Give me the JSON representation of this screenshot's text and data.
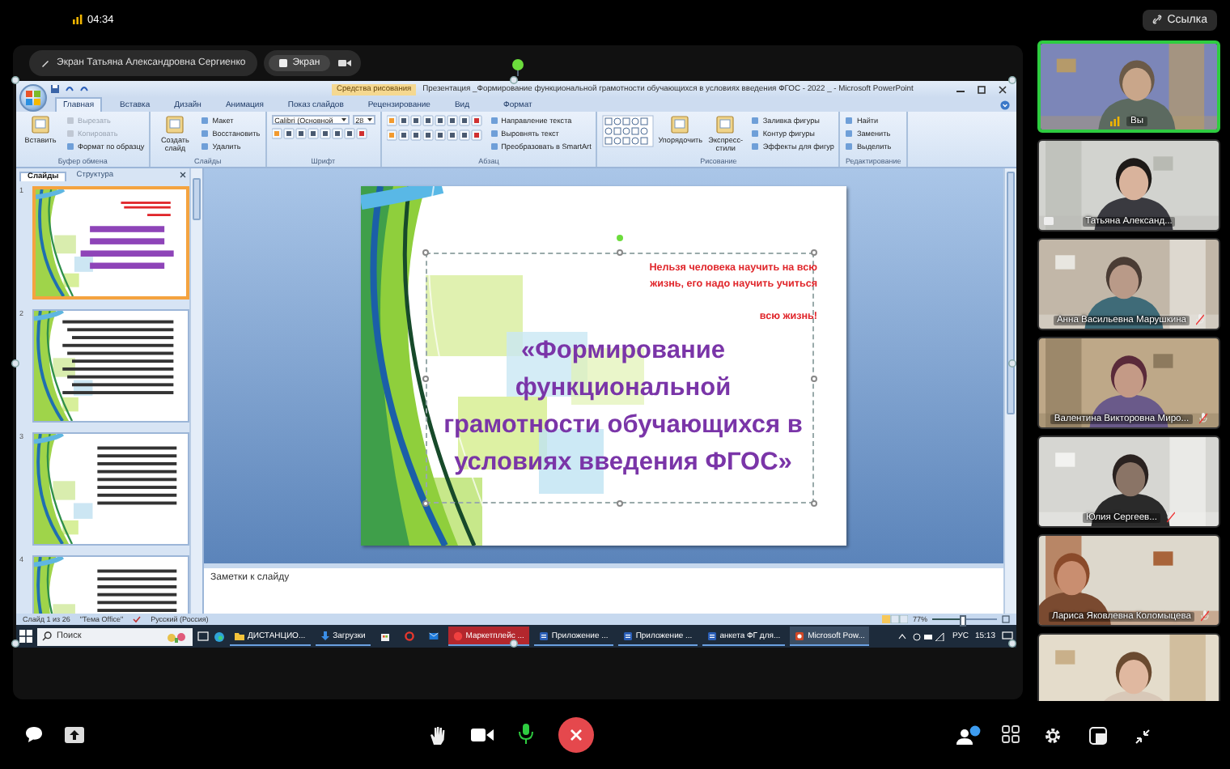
{
  "status_bar": {
    "time": "04:34"
  },
  "link_button": "Ссылка",
  "share_pills": [
    {
      "label": "Экран Татьяна Александровна Сергиенко",
      "kind": "presenter"
    },
    {
      "label": "Экран",
      "kind": "screen"
    }
  ],
  "powerpoint": {
    "title": "Презентация _Формирование функциональной грамотности обучающихся в условиях введения ФГОС - 2022 _ - Microsoft PowerPoint",
    "context_tab": "Средства рисования",
    "tabs": [
      {
        "label": "Главная",
        "selected": true
      },
      {
        "label": "Вставка",
        "selected": false
      },
      {
        "label": "Дизайн",
        "selected": false
      },
      {
        "label": "Анимация",
        "selected": false
      },
      {
        "label": "Показ слайдов",
        "selected": false
      },
      {
        "label": "Рецензирование",
        "selected": false
      },
      {
        "label": "Вид",
        "selected": false
      },
      {
        "label": "Формат",
        "selected": false
      }
    ],
    "ribbon_groups": [
      {
        "title": "Буфер обмена",
        "columns": [
          [
            {
              "kind": "large",
              "label": "Вставить"
            }
          ],
          [
            {
              "kind": "small",
              "label": "Вырезать",
              "disabled": true
            },
            {
              "kind": "small",
              "label": "Копировать",
              "disabled": true
            },
            {
              "kind": "small",
              "label": "Формат по образцу",
              "disabled": false
            }
          ]
        ]
      },
      {
        "title": "Слайды",
        "columns": [
          [
            {
              "kind": "large",
              "label": "Создать слайд"
            }
          ],
          [
            {
              "kind": "small",
              "label": "Макет",
              "disabled": false
            },
            {
              "kind": "small",
              "label": "Восстановить",
              "disabled": false
            },
            {
              "kind": "small",
              "label": "Удалить",
              "disabled": false
            }
          ]
        ]
      },
      {
        "title": "Шрифт",
        "columns": [
          [
            {
              "kind": "fields",
              "fields": [
                "Calibri (Основной",
                "28"
              ]
            },
            {
              "kind": "tools"
            }
          ]
        ]
      },
      {
        "title": "Абзац",
        "columns": [
          [
            {
              "kind": "tools"
            },
            {
              "kind": "tools"
            }
          ],
          [
            {
              "kind": "small",
              "label": "Направление текста",
              "disabled": false
            },
            {
              "kind": "small",
              "label": "Выровнять текст",
              "disabled": false
            },
            {
              "kind": "small",
              "label": "Преобразовать в SmartArt",
              "disabled": false
            }
          ]
        ]
      },
      {
        "title": "Рисование",
        "columns": [
          [
            {
              "kind": "gallery"
            }
          ],
          [
            {
              "kind": "large",
              "label": "Упорядочить"
            }
          ],
          [
            {
              "kind": "large",
              "label": "Экспресс-стили"
            }
          ],
          [
            {
              "kind": "small",
              "label": "Заливка фигуры",
              "disabled": false
            },
            {
              "kind": "small",
              "label": "Контур фигуры",
              "disabled": false
            },
            {
              "kind": "small",
              "label": "Эффекты для фигур",
              "disabled": false
            }
          ]
        ]
      },
      {
        "title": "Редактирование",
        "columns": [
          [
            {
              "kind": "small",
              "label": "Найти",
              "disabled": false
            },
            {
              "kind": "small",
              "label": "Заменить",
              "disabled": false
            },
            {
              "kind": "small",
              "label": "Выделить",
              "disabled": false
            }
          ]
        ]
      }
    ],
    "pane_tabs": [
      {
        "label": "Слайды",
        "selected": true
      },
      {
        "label": "Структура",
        "selected": false
      }
    ],
    "thumbnails": [
      {
        "number": "1",
        "selected": true
      },
      {
        "number": "2",
        "selected": false
      },
      {
        "number": "3",
        "selected": false
      },
      {
        "number": "4",
        "selected": false
      }
    ],
    "slide": {
      "epigraph": [
        "Нельзя человека научить на всю жизнь, его надо научить учиться",
        "всю жизнь!"
      ],
      "title": "«Формирование функциональной грамотности обучающихся в условиях введения ФГОС»"
    },
    "notes_placeholder": "Заметки к слайду",
    "status": [
      "Слайд 1 из 26",
      "\"Тема Office\"",
      "Русский (Россия)"
    ],
    "zoom": {
      "reading": "77%",
      "level": 0.45
    }
  },
  "taskbar": {
    "search_placeholder": "Поиск",
    "apps": [
      {
        "kind": "folder",
        "label": "ДИСТАНЦИО...",
        "running": true,
        "attention": false,
        "selected": false
      },
      {
        "kind": "download",
        "label": "Загрузки",
        "running": true,
        "attention": false,
        "selected": false
      },
      {
        "kind": "store",
        "running": false,
        "attention": false,
        "selected": false
      },
      {
        "kind": "opera",
        "running": false,
        "attention": false,
        "selected": false
      },
      {
        "kind": "mail",
        "running": false,
        "attention": false,
        "selected": false
      },
      {
        "kind": "web",
        "label": "Маркетплейс ...",
        "running": true,
        "attention": true,
        "selected": false
      },
      {
        "kind": "word",
        "label": "Приложение ...",
        "running": true,
        "attention": false,
        "selected": false
      },
      {
        "kind": "word",
        "label": "Приложение ...",
        "running": true,
        "attention": false,
        "selected": false
      },
      {
        "kind": "word",
        "label": "анкета ФГ для...",
        "running": true,
        "attention": false,
        "selected": false
      },
      {
        "kind": "ppt",
        "label": "Microsoft Pow...",
        "running": true,
        "attention": false,
        "selected": true
      }
    ],
    "language": "РУС",
    "time": "15:13"
  },
  "participants": [
    {
      "name": "Вы",
      "kind": "self",
      "speaking": true,
      "muted": false
    },
    {
      "name": "Татьяна Александ...",
      "kind": "presenter",
      "speaking": false,
      "muted": false
    },
    {
      "name": "Анна Васильевна Марушкина",
      "kind": "guest",
      "speaking": false,
      "muted": true
    },
    {
      "name": "Валентина Викторовна Миро...",
      "kind": "guest",
      "speaking": false,
      "muted": true
    },
    {
      "name": "Юлия Сергеев...",
      "kind": "guest",
      "speaking": false,
      "muted": true
    },
    {
      "name": "Лариса Яковлевна Коломыцева",
      "kind": "guest",
      "speaking": false,
      "muted": true
    },
    {
      "kind": "guest",
      "speaking": false
    }
  ]
}
